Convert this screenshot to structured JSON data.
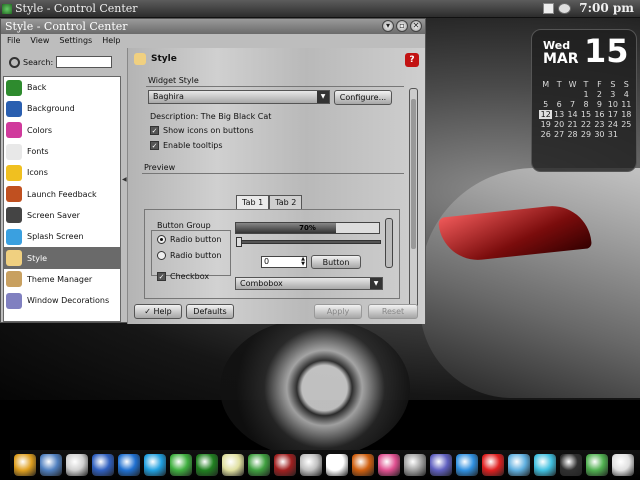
{
  "taskbar": {
    "task_title": "Style - Control Center",
    "clock": "7:00 pm"
  },
  "window": {
    "title": "Style - Control Center"
  },
  "menu": [
    "File",
    "View",
    "Settings",
    "Help"
  ],
  "search": {
    "label": "Search:",
    "value": ""
  },
  "sidebar": {
    "items": [
      {
        "label": "Back",
        "color": "#2e8b2e"
      },
      {
        "label": "Background",
        "color": "#2a5fb0"
      },
      {
        "label": "Colors",
        "color": "#d03a9c"
      },
      {
        "label": "Fonts",
        "color": "#e8e8e8"
      },
      {
        "label": "Icons",
        "color": "#f0c020"
      },
      {
        "label": "Launch Feedback",
        "color": "#c05020"
      },
      {
        "label": "Screen Saver",
        "color": "#444444"
      },
      {
        "label": "Splash Screen",
        "color": "#3aa0e0"
      },
      {
        "label": "Style",
        "color": "#f0d080"
      },
      {
        "label": "Theme Manager",
        "color": "#c8a060"
      },
      {
        "label": "Window Decorations",
        "color": "#8080c0"
      }
    ]
  },
  "panel": {
    "title": "Style",
    "help_icon": "help-icon",
    "widget_style_label": "Widget Style",
    "style_combo": "Baghira",
    "configure": "Configure...",
    "description": "Description: The Big Black Cat",
    "show_icons": "Show icons on buttons",
    "enable_tooltips": "Enable tooltips",
    "preview_label": "Preview",
    "tabs": [
      "Tab 1",
      "Tab 2"
    ],
    "button_group": "Button Group",
    "radio1": "Radio button",
    "radio2": "Radio button",
    "checkbox": "Checkbox",
    "progress": {
      "value": 70,
      "label": "70%"
    },
    "spin_value": "0",
    "button": "Button",
    "combobox": "Combobox"
  },
  "footer": {
    "help": "Help",
    "defaults": "Defaults",
    "apply": "Apply",
    "reset": "Reset"
  },
  "calendar": {
    "weekday": "Wed",
    "month": "MAR",
    "day": "15",
    "headers": [
      "M",
      "T",
      "W",
      "T",
      "F",
      "S",
      "S"
    ],
    "cells": [
      "",
      "",
      "",
      "1",
      "2",
      "3",
      "4",
      "5",
      "6",
      "7",
      "8",
      "9",
      "10",
      "11",
      "12",
      "13",
      "14",
      "15",
      "16",
      "17",
      "18",
      "19",
      "20",
      "21",
      "22",
      "23",
      "24",
      "25",
      "26",
      "27",
      "28",
      "29",
      "30",
      "31",
      ""
    ],
    "today_index": 14
  },
  "dock_icons": [
    "#e0a020",
    "#5080c0",
    "#d0d0d0",
    "#3060c0",
    "#2070d0",
    "#20a0e0",
    "#40b040",
    "#208020",
    "#e0e0a0",
    "#40a040",
    "#a02020",
    "#c0c0c0",
    "#ffffff",
    "#d06010",
    "#e05090",
    "#a0a0a0",
    "#6060c0",
    "#3090e0",
    "#e02020",
    "#60b0e0",
    "#40c0e0",
    "#303030",
    "#50b050",
    "#e0e0e0"
  ]
}
